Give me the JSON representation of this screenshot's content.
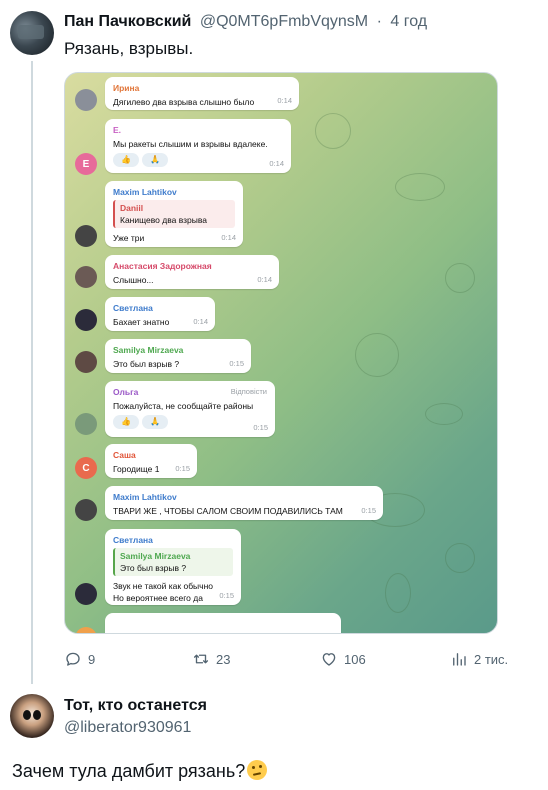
{
  "tweet1": {
    "author_name": "Пан Пачковский",
    "handle": "@Q0MT6pFmbVqynsM",
    "separator": "·",
    "time": "4 год",
    "text": "Рязань, взрывы.",
    "stats": {
      "replies": "9",
      "retweets": "23",
      "likes": "106",
      "views": "2 тис."
    }
  },
  "chat": {
    "messages": [
      {
        "sender": "Ирина",
        "sender_color": "#e1763a",
        "text": "Дягилево два взрыва слышно было",
        "time": "0:14",
        "avatar_letter": "",
        "avatar_color": "#8a8f99"
      },
      {
        "sender": "Е.",
        "sender_color": "#c75fc3",
        "text": "Мы ракеты слышим и взрывы вдалеке.",
        "time": "0:14",
        "avatar_letter": "Е",
        "avatar_color": "#e76a9a",
        "reactions": [
          "👍",
          "🙏"
        ]
      },
      {
        "sender": "Maxim Lahtikov",
        "sender_color": "#3f7ccc",
        "reply_name": "Daniil",
        "reply_text": "Канищево два взрыва",
        "text": "Уже три",
        "time": "0:14",
        "avatar_letter": "",
        "avatar_color": "#444"
      },
      {
        "sender": "Анастасия Задорожная",
        "sender_color": "#d64a6a",
        "text": "Слышно...",
        "time": "0:14",
        "avatar_letter": "",
        "avatar_color": "#6b5a55"
      },
      {
        "sender": "Светлана",
        "sender_color": "#3f7ccc",
        "text": "Бахает знатно",
        "time": "0:14",
        "avatar_letter": "",
        "avatar_color": "#2b2b3a"
      },
      {
        "sender": "Samilya Mirzaeva",
        "sender_color": "#4fa850",
        "text": "Это был взрыв ?",
        "time": "0:15",
        "avatar_letter": "",
        "avatar_color": "#5e4a44"
      },
      {
        "sender": "Ольга",
        "sender_color": "#9b59c7",
        "tag": "Відповісти",
        "text": "Пожалуйста, не сообщайте районы",
        "time": "0:15",
        "avatar_letter": "",
        "avatar_color": "#7a9a7a",
        "reactions": [
          "👍",
          "🙏"
        ]
      },
      {
        "sender": "Саша",
        "sender_color": "#e1563a",
        "text": "Городище 1",
        "time": "0:15",
        "avatar_letter": "С",
        "avatar_color": "#e96a4e"
      },
      {
        "sender": "Maxim Lahtikov",
        "sender_color": "#3f7ccc",
        "text": "ТВАРИ ЖЕ , ЧТОБЫ САЛОМ СВОИМ ПОДАВИЛИСЬ ТАМ",
        "time": "0:15",
        "avatar_letter": "",
        "avatar_color": "#444"
      },
      {
        "sender": "Светлана",
        "sender_color": "#3f7ccc",
        "reply_name": "Samilya Mirzaeva",
        "reply_text": "Это был взрыв ?",
        "text_lines": [
          "Звук не такой как обычно",
          "Но вероятнее всего да"
        ],
        "time": "0:15",
        "avatar_letter": "",
        "avatar_color": "#2b2b3a"
      }
    ]
  },
  "tweet2": {
    "author_name": "Тот, кто останется",
    "handle": "@liberator930961",
    "text": "Зачем тула дамбит рязань?"
  },
  "icons": {
    "reply": "speech-bubble-icon",
    "retweet": "retweet-icon",
    "like": "heart-icon",
    "views": "bar-chart-icon",
    "emoji": "thinking-face-emoji"
  },
  "colors": {
    "text_primary": "#0f1419",
    "text_secondary": "#536471",
    "border": "#cfd9de"
  }
}
